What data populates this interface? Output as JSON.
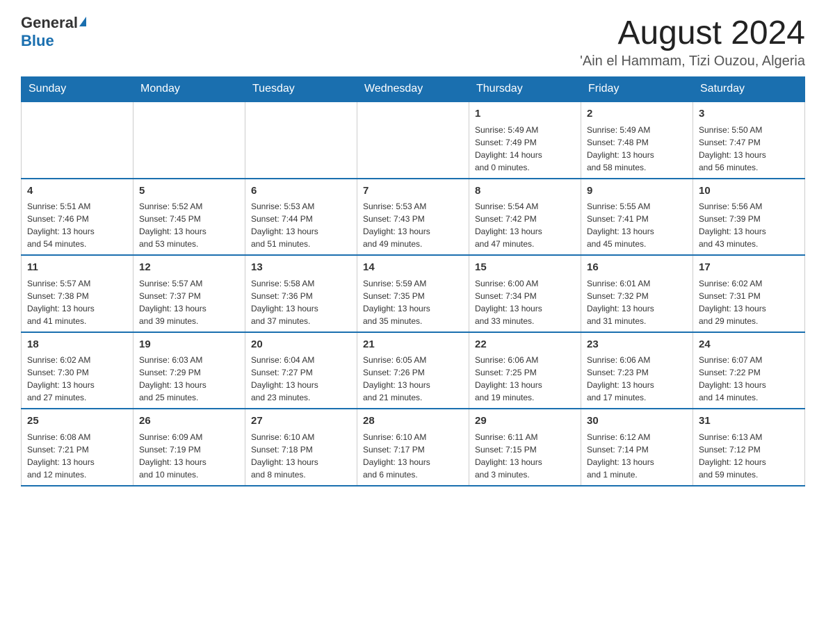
{
  "header": {
    "logo_general": "General",
    "logo_blue": "Blue",
    "month_title": "August 2024",
    "location": "'Ain el Hammam, Tizi Ouzou, Algeria"
  },
  "weekdays": [
    "Sunday",
    "Monday",
    "Tuesday",
    "Wednesday",
    "Thursday",
    "Friday",
    "Saturday"
  ],
  "weeks": [
    [
      {
        "day": "",
        "info": ""
      },
      {
        "day": "",
        "info": ""
      },
      {
        "day": "",
        "info": ""
      },
      {
        "day": "",
        "info": ""
      },
      {
        "day": "1",
        "info": "Sunrise: 5:49 AM\nSunset: 7:49 PM\nDaylight: 14 hours\nand 0 minutes."
      },
      {
        "day": "2",
        "info": "Sunrise: 5:49 AM\nSunset: 7:48 PM\nDaylight: 13 hours\nand 58 minutes."
      },
      {
        "day": "3",
        "info": "Sunrise: 5:50 AM\nSunset: 7:47 PM\nDaylight: 13 hours\nand 56 minutes."
      }
    ],
    [
      {
        "day": "4",
        "info": "Sunrise: 5:51 AM\nSunset: 7:46 PM\nDaylight: 13 hours\nand 54 minutes."
      },
      {
        "day": "5",
        "info": "Sunrise: 5:52 AM\nSunset: 7:45 PM\nDaylight: 13 hours\nand 53 minutes."
      },
      {
        "day": "6",
        "info": "Sunrise: 5:53 AM\nSunset: 7:44 PM\nDaylight: 13 hours\nand 51 minutes."
      },
      {
        "day": "7",
        "info": "Sunrise: 5:53 AM\nSunset: 7:43 PM\nDaylight: 13 hours\nand 49 minutes."
      },
      {
        "day": "8",
        "info": "Sunrise: 5:54 AM\nSunset: 7:42 PM\nDaylight: 13 hours\nand 47 minutes."
      },
      {
        "day": "9",
        "info": "Sunrise: 5:55 AM\nSunset: 7:41 PM\nDaylight: 13 hours\nand 45 minutes."
      },
      {
        "day": "10",
        "info": "Sunrise: 5:56 AM\nSunset: 7:39 PM\nDaylight: 13 hours\nand 43 minutes."
      }
    ],
    [
      {
        "day": "11",
        "info": "Sunrise: 5:57 AM\nSunset: 7:38 PM\nDaylight: 13 hours\nand 41 minutes."
      },
      {
        "day": "12",
        "info": "Sunrise: 5:57 AM\nSunset: 7:37 PM\nDaylight: 13 hours\nand 39 minutes."
      },
      {
        "day": "13",
        "info": "Sunrise: 5:58 AM\nSunset: 7:36 PM\nDaylight: 13 hours\nand 37 minutes."
      },
      {
        "day": "14",
        "info": "Sunrise: 5:59 AM\nSunset: 7:35 PM\nDaylight: 13 hours\nand 35 minutes."
      },
      {
        "day": "15",
        "info": "Sunrise: 6:00 AM\nSunset: 7:34 PM\nDaylight: 13 hours\nand 33 minutes."
      },
      {
        "day": "16",
        "info": "Sunrise: 6:01 AM\nSunset: 7:32 PM\nDaylight: 13 hours\nand 31 minutes."
      },
      {
        "day": "17",
        "info": "Sunrise: 6:02 AM\nSunset: 7:31 PM\nDaylight: 13 hours\nand 29 minutes."
      }
    ],
    [
      {
        "day": "18",
        "info": "Sunrise: 6:02 AM\nSunset: 7:30 PM\nDaylight: 13 hours\nand 27 minutes."
      },
      {
        "day": "19",
        "info": "Sunrise: 6:03 AM\nSunset: 7:29 PM\nDaylight: 13 hours\nand 25 minutes."
      },
      {
        "day": "20",
        "info": "Sunrise: 6:04 AM\nSunset: 7:27 PM\nDaylight: 13 hours\nand 23 minutes."
      },
      {
        "day": "21",
        "info": "Sunrise: 6:05 AM\nSunset: 7:26 PM\nDaylight: 13 hours\nand 21 minutes."
      },
      {
        "day": "22",
        "info": "Sunrise: 6:06 AM\nSunset: 7:25 PM\nDaylight: 13 hours\nand 19 minutes."
      },
      {
        "day": "23",
        "info": "Sunrise: 6:06 AM\nSunset: 7:23 PM\nDaylight: 13 hours\nand 17 minutes."
      },
      {
        "day": "24",
        "info": "Sunrise: 6:07 AM\nSunset: 7:22 PM\nDaylight: 13 hours\nand 14 minutes."
      }
    ],
    [
      {
        "day": "25",
        "info": "Sunrise: 6:08 AM\nSunset: 7:21 PM\nDaylight: 13 hours\nand 12 minutes."
      },
      {
        "day": "26",
        "info": "Sunrise: 6:09 AM\nSunset: 7:19 PM\nDaylight: 13 hours\nand 10 minutes."
      },
      {
        "day": "27",
        "info": "Sunrise: 6:10 AM\nSunset: 7:18 PM\nDaylight: 13 hours\nand 8 minutes."
      },
      {
        "day": "28",
        "info": "Sunrise: 6:10 AM\nSunset: 7:17 PM\nDaylight: 13 hours\nand 6 minutes."
      },
      {
        "day": "29",
        "info": "Sunrise: 6:11 AM\nSunset: 7:15 PM\nDaylight: 13 hours\nand 3 minutes."
      },
      {
        "day": "30",
        "info": "Sunrise: 6:12 AM\nSunset: 7:14 PM\nDaylight: 13 hours\nand 1 minute."
      },
      {
        "day": "31",
        "info": "Sunrise: 6:13 AM\nSunset: 7:12 PM\nDaylight: 12 hours\nand 59 minutes."
      }
    ]
  ]
}
